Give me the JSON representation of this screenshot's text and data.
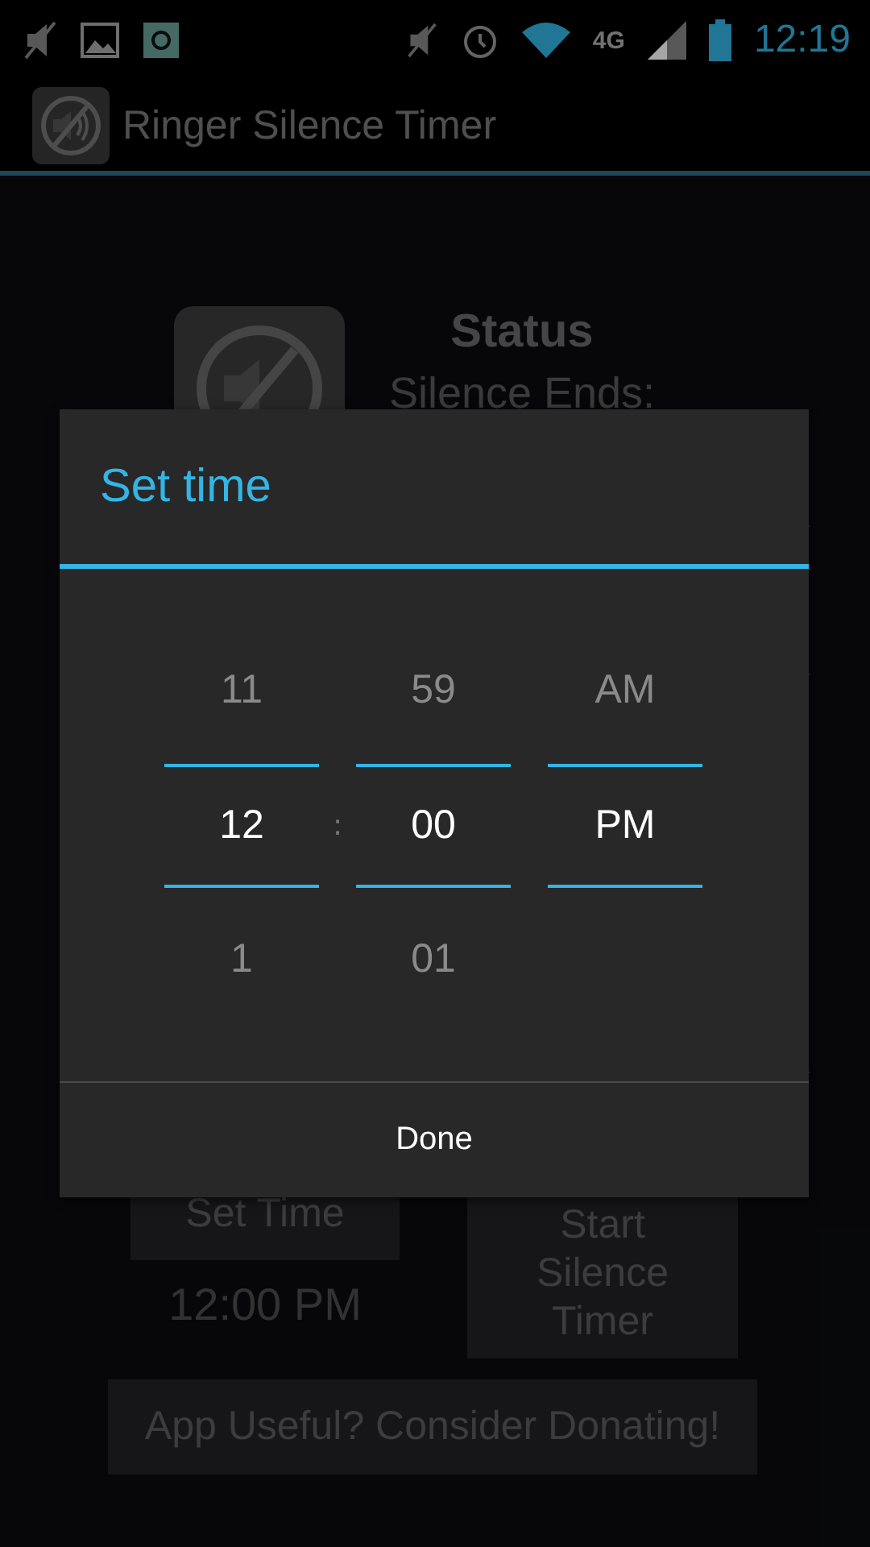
{
  "status_bar": {
    "time": "12:19",
    "network": "4G"
  },
  "action_bar": {
    "title": "Ringer Silence Timer"
  },
  "status": {
    "heading": "Status",
    "silence_ends": "Silence Ends:"
  },
  "set_time_button": "Set Time",
  "chosen_time": "12:00 PM",
  "start_button": "Start Silence Timer",
  "donate_button": "App Useful? Consider Donating!",
  "dialog": {
    "title": "Set time",
    "pickers": [
      {
        "above": "11",
        "value": "12",
        "below": "1"
      },
      {
        "above": "59",
        "value": "00",
        "below": "01"
      },
      {
        "above": "AM",
        "value": "PM"
      }
    ],
    "separator": ":",
    "done": "Done"
  }
}
